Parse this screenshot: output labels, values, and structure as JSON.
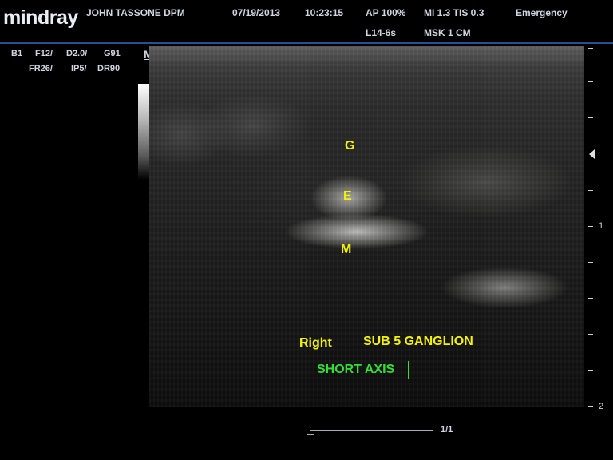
{
  "header": {
    "brand": "mindray",
    "operator": "JOHN TASSONE DPM",
    "date": "07/19/2013",
    "time": "10:23:15",
    "acoustic_power": "AP  100%",
    "indices": "MI 1.3 TIS 0.3",
    "mode_label": "Emergency",
    "probe": "L14-6s",
    "preset": "MSK  1 CM"
  },
  "params": {
    "b_mode": "B1",
    "freq": "F12/",
    "depth": "D2.0/",
    "gain": "G91",
    "frame_rate": "FR26/",
    "image_proc": "IP5/",
    "dyn_range": "DR90"
  },
  "orientation_marker": "M",
  "annotations": {
    "g": "G",
    "e": "E",
    "m": "M",
    "side": "Right",
    "title": "SUB 5 GANGLION",
    "view": "SHORT AXIS"
  },
  "depth_scale": {
    "mark_1": "1",
    "mark_2": "2"
  },
  "cine": {
    "frame_counter": "1/1"
  },
  "colors": {
    "annotation_yellow": "#f3f300",
    "annotation_green": "#33dd33",
    "header_divider": "#2a4f9a"
  }
}
